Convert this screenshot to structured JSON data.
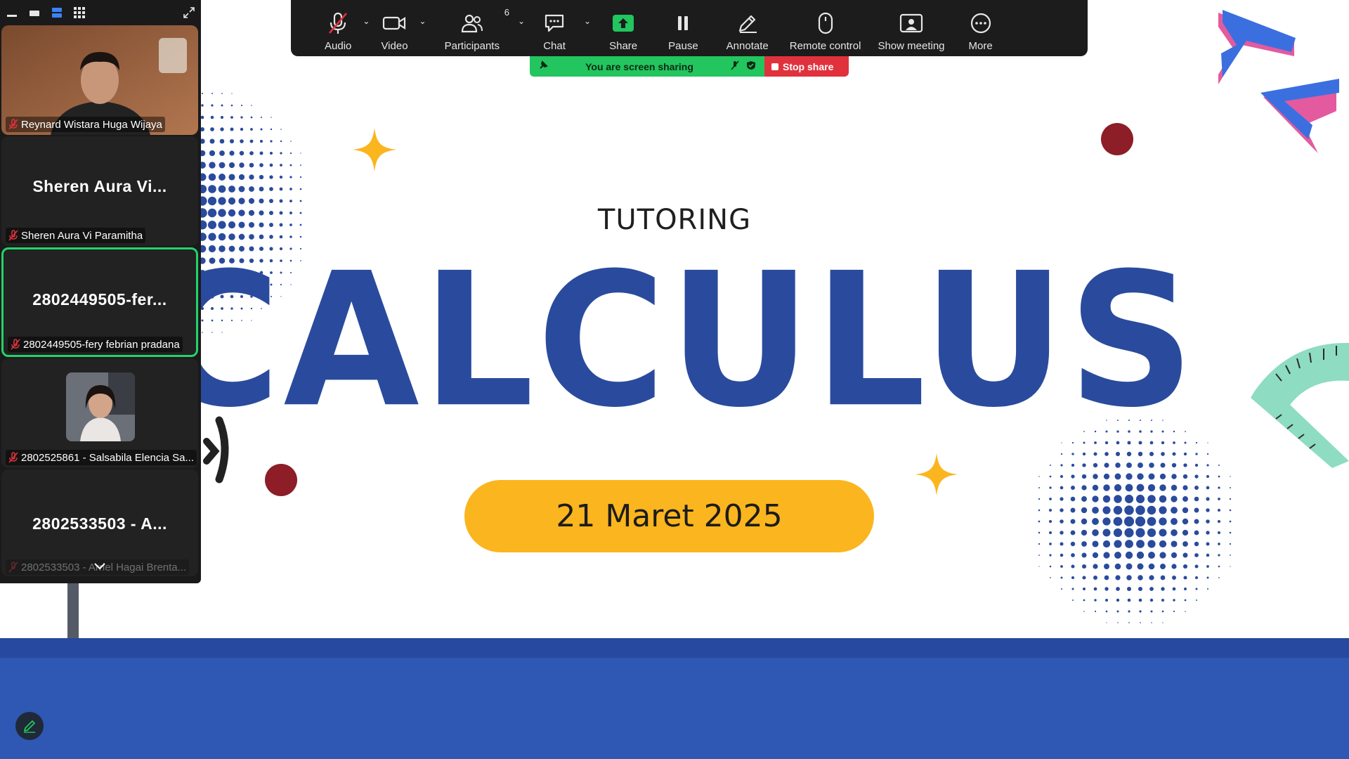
{
  "toolbar": {
    "items": [
      {
        "label": "Audio",
        "icon": "microphone-muted-icon"
      },
      {
        "label": "Video",
        "icon": "video-camera-icon"
      },
      {
        "label": "Participants",
        "icon": "participants-icon",
        "count": "6"
      },
      {
        "label": "Chat",
        "icon": "chat-icon"
      },
      {
        "label": "Share",
        "icon": "share-screen-icon"
      },
      {
        "label": "Pause",
        "icon": "pause-icon"
      },
      {
        "label": "Annotate",
        "icon": "pencil-icon"
      },
      {
        "label": "Remote control",
        "icon": "mouse-icon"
      },
      {
        "label": "Show meeting",
        "icon": "meeting-window-icon"
      },
      {
        "label": "More",
        "icon": "more-icon"
      }
    ]
  },
  "share_banner": {
    "status": "You are screen sharing",
    "stop_label": "Stop share"
  },
  "participants": {
    "tiles": [
      {
        "display": "",
        "name": "Reynard Wistara Huga Wijaya",
        "type": "video"
      },
      {
        "display": "Sheren Aura Vi...",
        "name": "Sheren Aura Vi Paramitha",
        "type": "name"
      },
      {
        "display": "2802449505-fer...",
        "name": "2802449505-fery febrian pradana",
        "type": "name",
        "active": true
      },
      {
        "display": "",
        "name": "2802525861 - Salsabila Elencia Sa...",
        "type": "avatar"
      },
      {
        "display": "2802533503 - A...",
        "name": "2802533503 - Arriel Hagai Brenta...",
        "type": "name"
      }
    ]
  },
  "slide": {
    "subtitle": "TUTORING",
    "title": "CALCULUS",
    "date": "21 Maret 2025"
  },
  "colors": {
    "slide_blue": "#2a4b9d",
    "band_blue": "#2f57b4",
    "pill_yellow": "#fbb51f",
    "share_green": "#22c55e",
    "stop_red": "#e0323d",
    "active_border": "#23d36a"
  }
}
